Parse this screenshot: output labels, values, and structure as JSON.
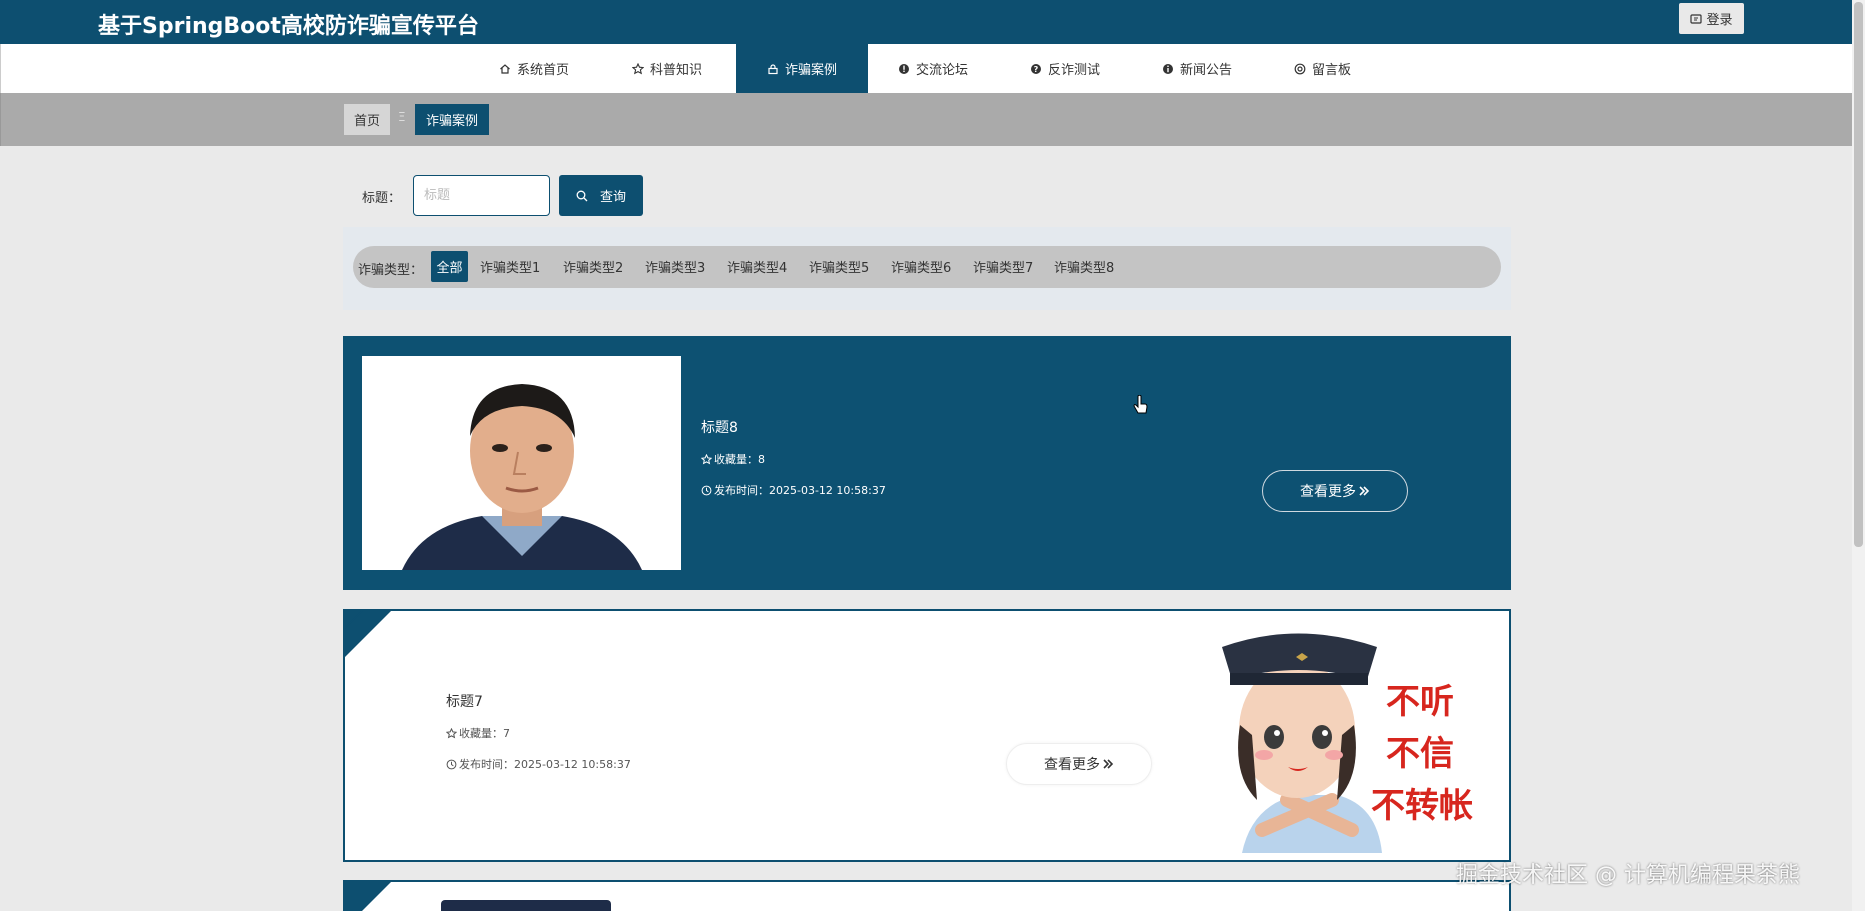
{
  "header": {
    "site_title": "基于SpringBoot高校防诈骗宣传平台",
    "login_label": "登录"
  },
  "nav": {
    "items": [
      {
        "label": "系统首页",
        "icon": "home-icon"
      },
      {
        "label": "科普知识",
        "icon": "star-icon"
      },
      {
        "label": "诈骗案例",
        "icon": "lock-icon",
        "active": true
      },
      {
        "label": "交流论坛",
        "icon": "info-icon"
      },
      {
        "label": "反诈测试",
        "icon": "question-icon"
      },
      {
        "label": "新闻公告",
        "icon": "info-icon"
      },
      {
        "label": "留言板",
        "icon": "message-icon"
      }
    ]
  },
  "breadcrumb": {
    "home": "首页",
    "separator": "Ξ",
    "current": "诈骗案例"
  },
  "search": {
    "label": "标题：",
    "placeholder": "标题",
    "button_label": "查询"
  },
  "filter": {
    "label": "诈骗类型：",
    "options": [
      "全部",
      "诈骗类型1",
      "诈骗类型2",
      "诈骗类型3",
      "诈骗类型4",
      "诈骗类型5",
      "诈骗类型6",
      "诈骗类型7",
      "诈骗类型8"
    ],
    "selected": "全部"
  },
  "cards": [
    {
      "title": "标题8",
      "favorites": "收藏量：8",
      "published": "发布时间：2025-03-12 10:58:37",
      "more_label": "查看更多"
    },
    {
      "title": "标题7",
      "favorites": "收藏量：7",
      "published": "发布时间：2025-03-12 10:58:37",
      "more_label": "查看更多",
      "poster_text": [
        "不听",
        "不信",
        "不转帐"
      ]
    }
  ],
  "watermark": "掘金技术社区 @ 计算机编程果茶熊",
  "colors": {
    "primary": "#0d4f70",
    "card_dark": "#0d5172",
    "breadcrumb_bar": "#aaaaaa",
    "page_bg": "#eaeaea",
    "poster_red": "#d7261e"
  }
}
